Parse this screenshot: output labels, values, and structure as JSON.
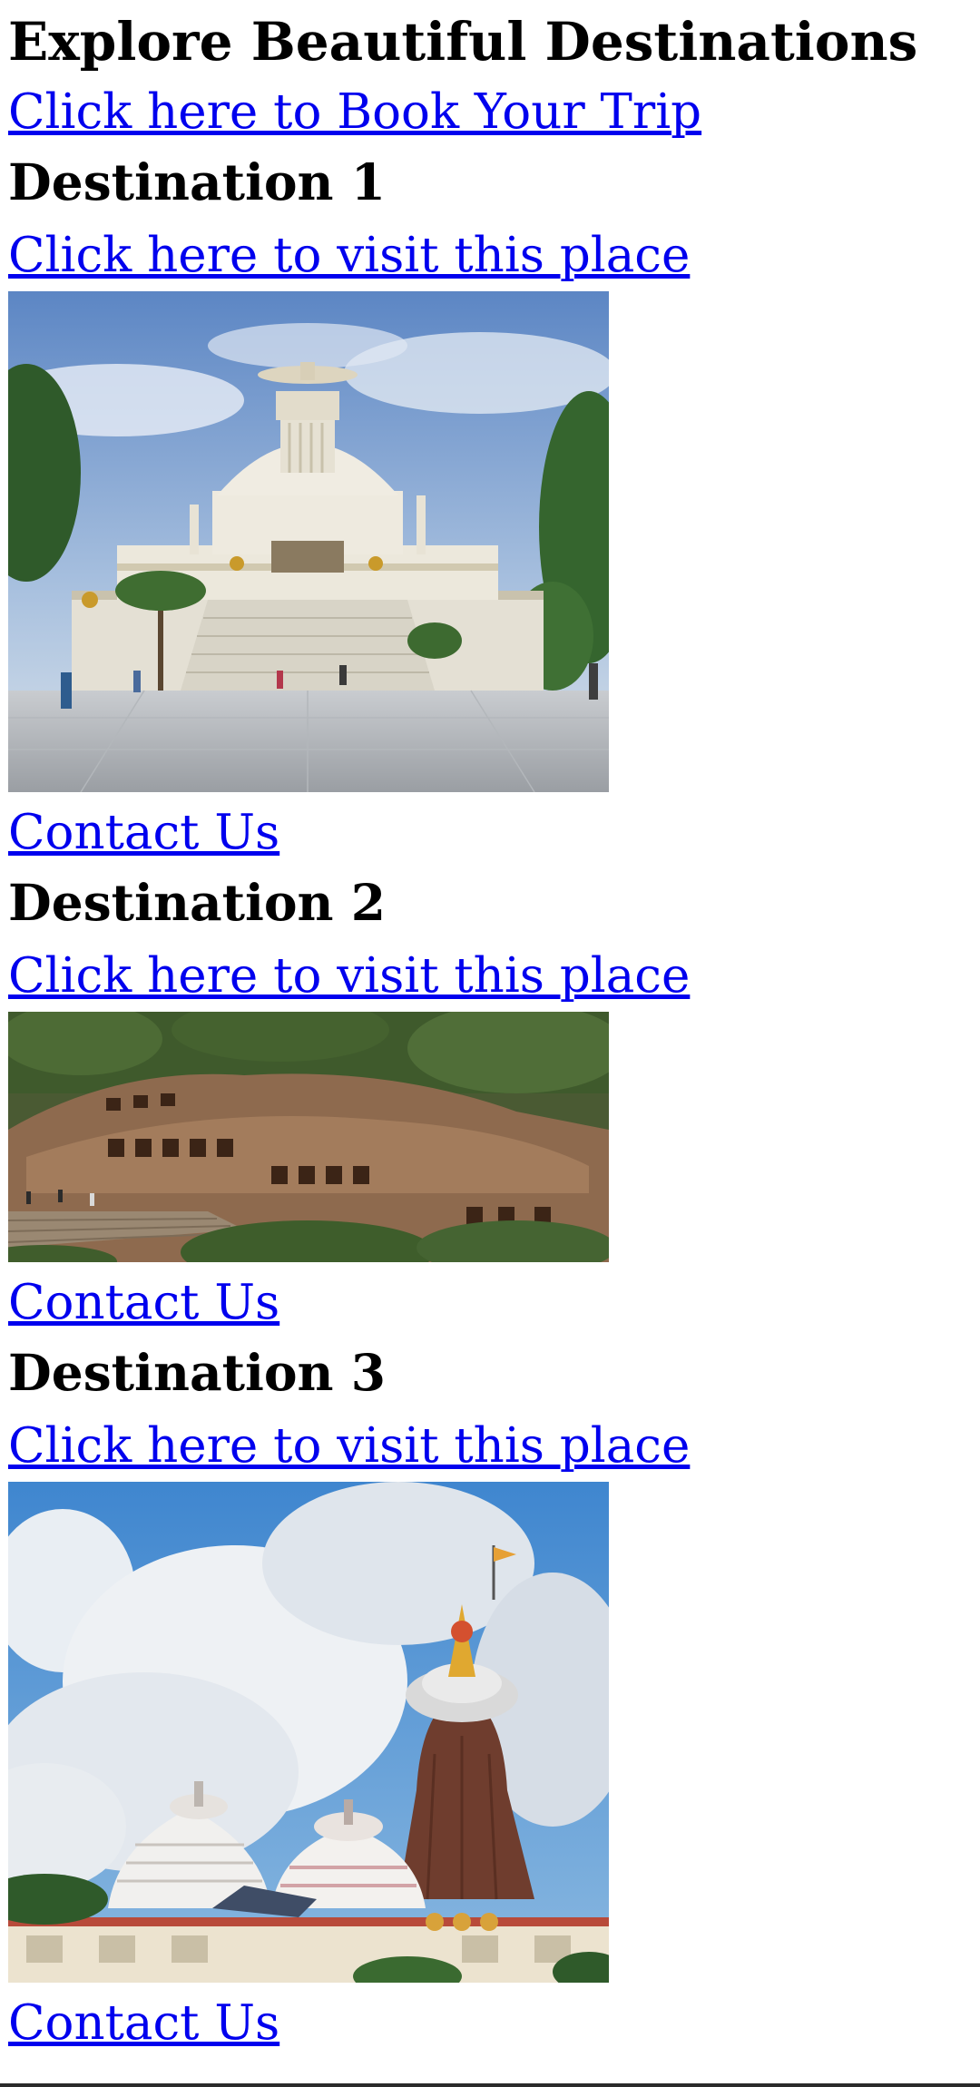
{
  "page": {
    "heading": "Explore Beautiful Destinations",
    "book_link": "Click here to Book Your Trip"
  },
  "destinations": [
    {
      "title": "Destination 1",
      "visit_link": "Click here to visit this place",
      "photo_subject": "white-stupa-peace-pagoda",
      "contact_link": "Contact Us"
    },
    {
      "title": "Destination 2",
      "visit_link": "Click here to visit this place",
      "photo_subject": "rock-cut-caves-hillside",
      "contact_link": "Contact Us"
    },
    {
      "title": "Destination 3",
      "visit_link": "Click here to visit this place",
      "photo_subject": "temple-towers-with-flag",
      "contact_link": "Contact Us"
    }
  ],
  "colors": {
    "link": "#0000ee",
    "text": "#000000",
    "background": "#ffffff"
  }
}
